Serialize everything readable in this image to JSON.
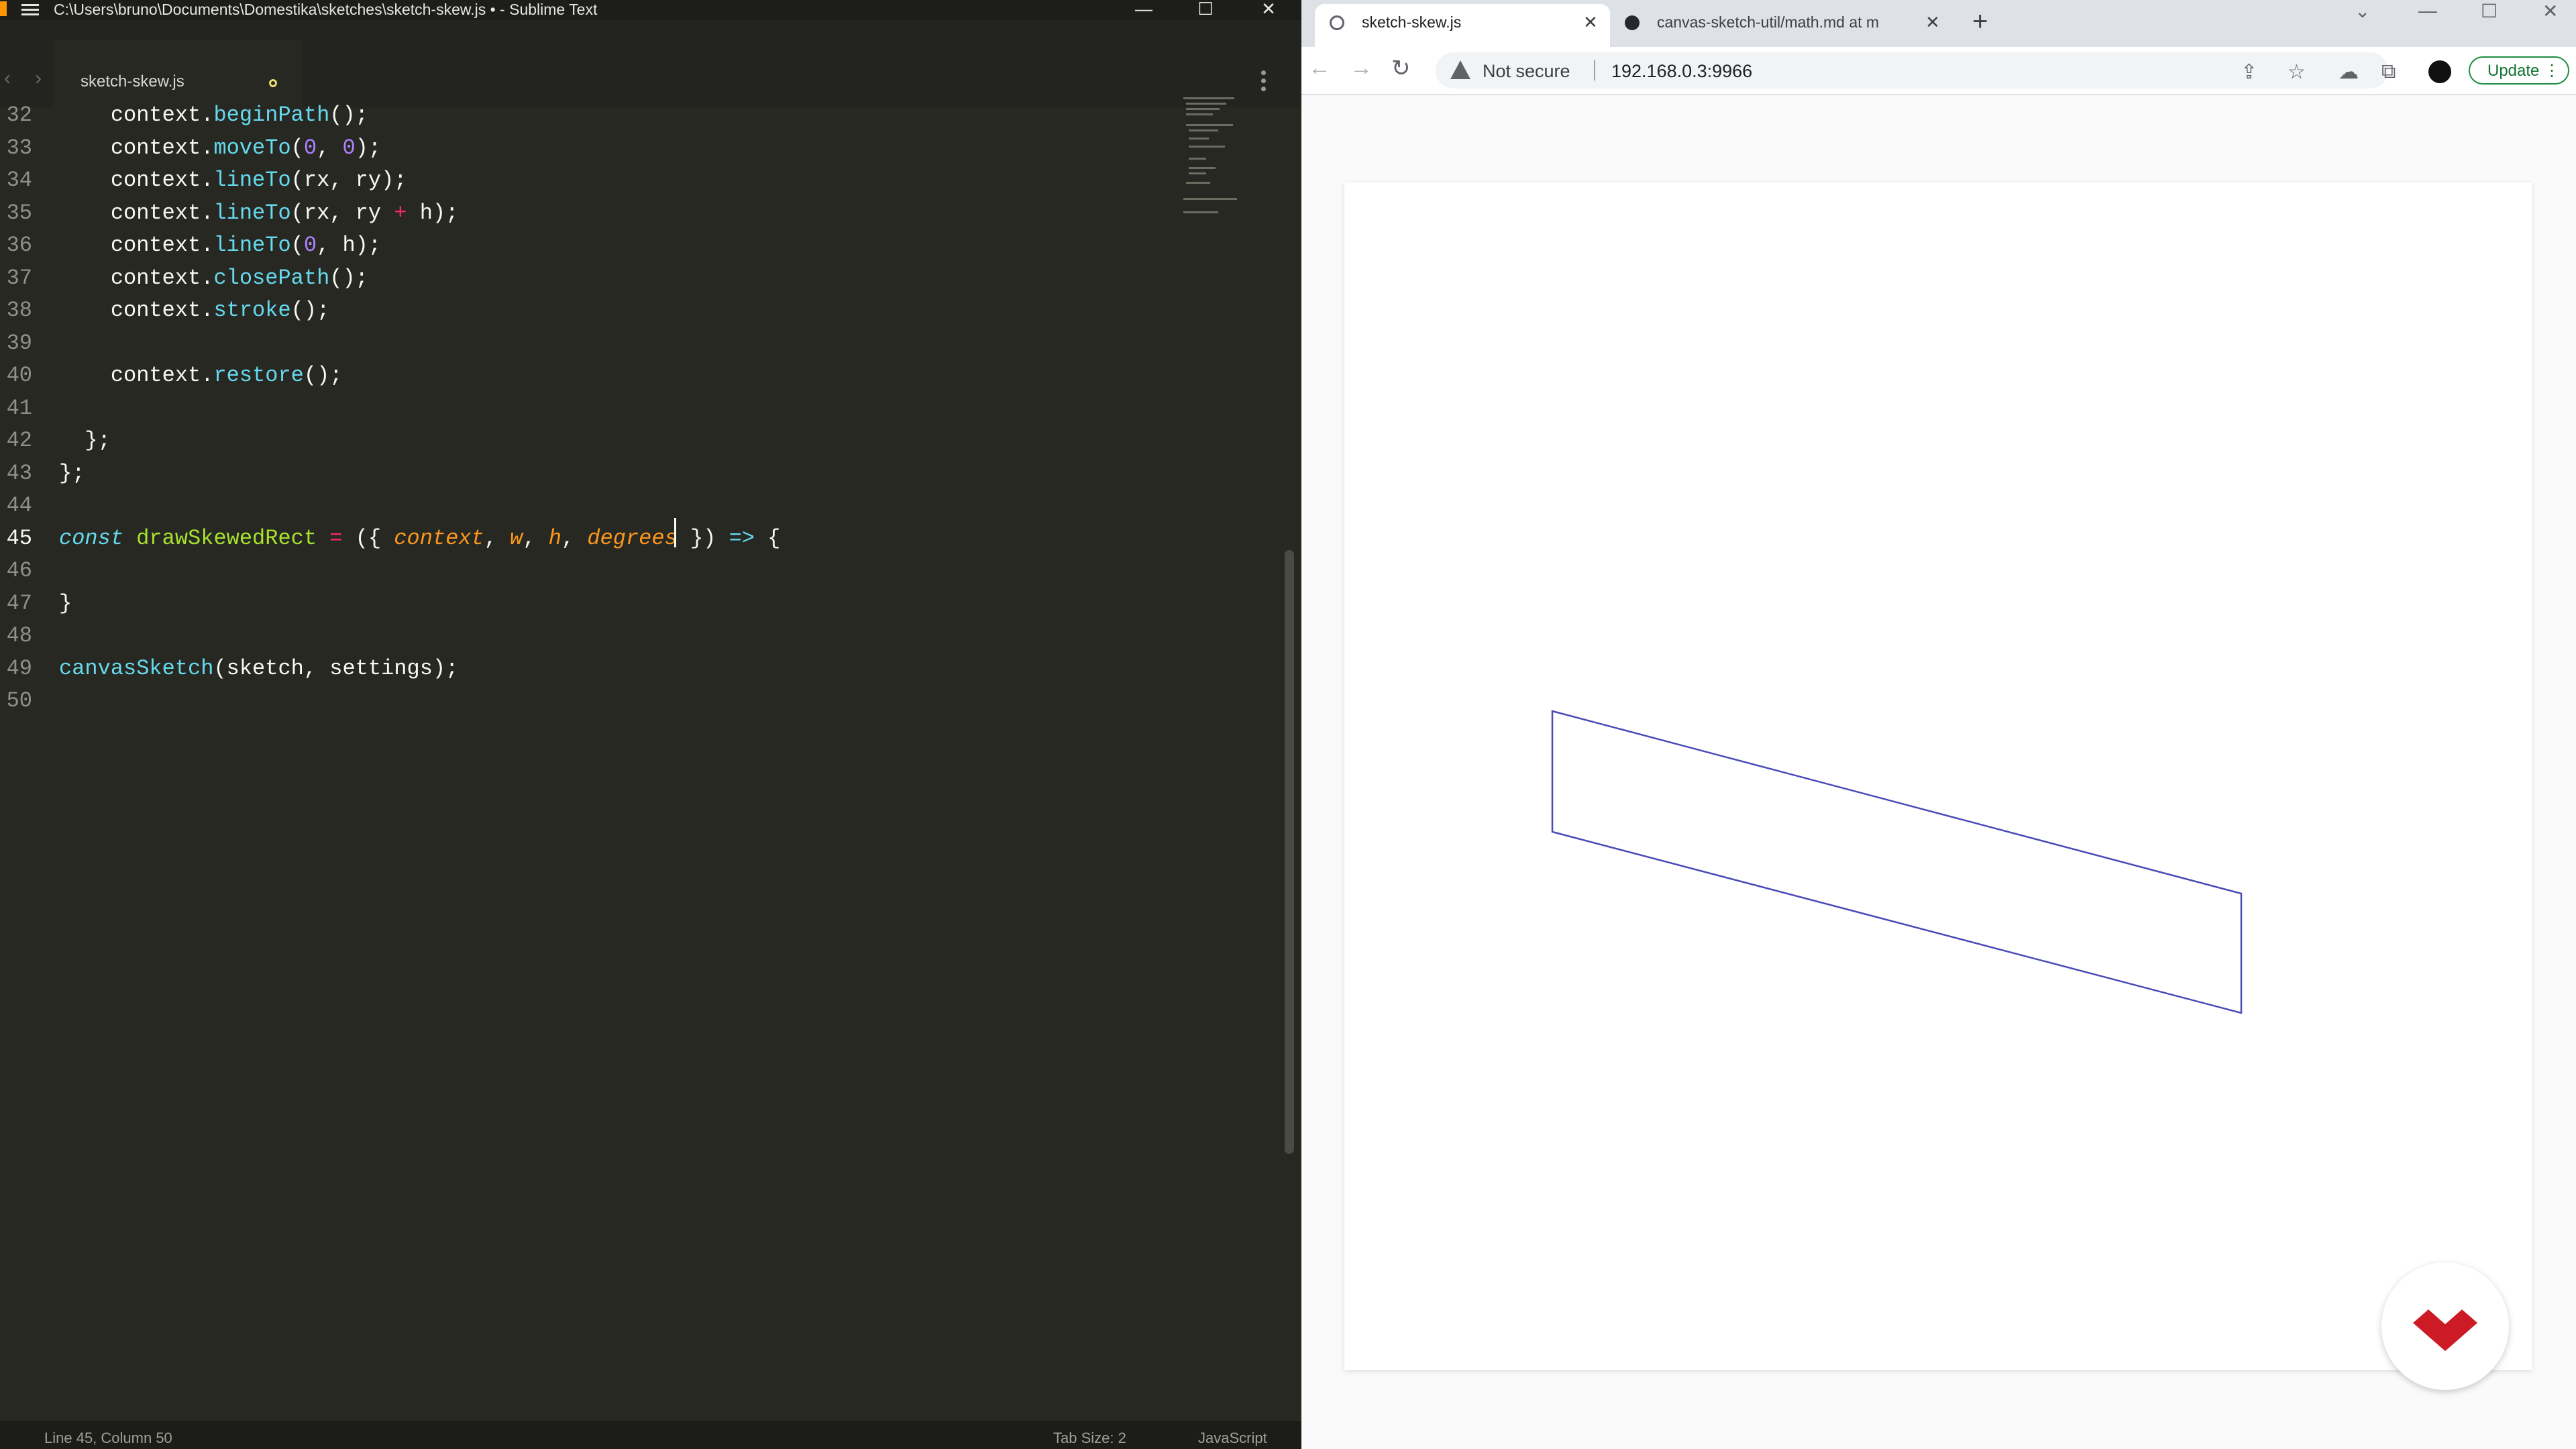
{
  "editor": {
    "window_title": "C:\\Users\\bruno\\Documents\\Domestika\\sketches\\sketch-skew.js • - Sublime Text",
    "window_controls": {
      "minimize": "—",
      "maximize": "☐",
      "close": "✕"
    },
    "tab": {
      "label": "sketch-skew.js"
    },
    "nav": {
      "back": "‹",
      "forward": "›"
    },
    "lines": [
      {
        "n": "32",
        "tokens": [
          {
            "t": "    context.",
            "c": ""
          },
          {
            "t": "beginPath",
            "c": "fn"
          },
          {
            "t": "();",
            "c": ""
          }
        ]
      },
      {
        "n": "33",
        "tokens": [
          {
            "t": "    context.",
            "c": ""
          },
          {
            "t": "moveTo",
            "c": "fn"
          },
          {
            "t": "(",
            "c": ""
          },
          {
            "t": "0",
            "c": "num"
          },
          {
            "t": ", ",
            "c": ""
          },
          {
            "t": "0",
            "c": "num"
          },
          {
            "t": ");",
            "c": ""
          }
        ]
      },
      {
        "n": "34",
        "tokens": [
          {
            "t": "    context.",
            "c": ""
          },
          {
            "t": "lineTo",
            "c": "fn"
          },
          {
            "t": "(rx, ry);",
            "c": ""
          }
        ]
      },
      {
        "n": "35",
        "tokens": [
          {
            "t": "    context.",
            "c": ""
          },
          {
            "t": "lineTo",
            "c": "fn"
          },
          {
            "t": "(rx, ry ",
            "c": ""
          },
          {
            "t": "+",
            "c": "op"
          },
          {
            "t": " h);",
            "c": ""
          }
        ]
      },
      {
        "n": "36",
        "tokens": [
          {
            "t": "    context.",
            "c": ""
          },
          {
            "t": "lineTo",
            "c": "fn"
          },
          {
            "t": "(",
            "c": ""
          },
          {
            "t": "0",
            "c": "num"
          },
          {
            "t": ", h);",
            "c": ""
          }
        ]
      },
      {
        "n": "37",
        "tokens": [
          {
            "t": "    context.",
            "c": ""
          },
          {
            "t": "closePath",
            "c": "fn"
          },
          {
            "t": "();",
            "c": ""
          }
        ]
      },
      {
        "n": "38",
        "tokens": [
          {
            "t": "    context.",
            "c": ""
          },
          {
            "t": "stroke",
            "c": "fn"
          },
          {
            "t": "();",
            "c": ""
          }
        ]
      },
      {
        "n": "39",
        "tokens": []
      },
      {
        "n": "40",
        "tokens": [
          {
            "t": "    context.",
            "c": ""
          },
          {
            "t": "restore",
            "c": "fn"
          },
          {
            "t": "();",
            "c": ""
          }
        ]
      },
      {
        "n": "41",
        "tokens": []
      },
      {
        "n": "42",
        "tokens": [
          {
            "t": "  };",
            "c": ""
          }
        ]
      },
      {
        "n": "43",
        "tokens": [
          {
            "t": "};",
            "c": ""
          }
        ]
      },
      {
        "n": "44",
        "tokens": []
      },
      {
        "n": "45",
        "tokens": [
          {
            "t": "const",
            "c": "kw"
          },
          {
            "t": " ",
            "c": ""
          },
          {
            "t": "drawSkewedRect",
            "c": "fnname"
          },
          {
            "t": " ",
            "c": ""
          },
          {
            "t": "=",
            "c": "op"
          },
          {
            "t": " ({ ",
            "c": ""
          },
          {
            "t": "context",
            "c": "param"
          },
          {
            "t": ", ",
            "c": ""
          },
          {
            "t": "w",
            "c": "param"
          },
          {
            "t": ", ",
            "c": ""
          },
          {
            "t": "h",
            "c": "param"
          },
          {
            "t": ", ",
            "c": ""
          },
          {
            "t": "degrees",
            "c": "param"
          },
          {
            "t": " }) ",
            "c": ""
          },
          {
            "t": "=>",
            "c": "kw"
          },
          {
            "t": " {",
            "c": ""
          }
        ],
        "current": true
      },
      {
        "n": "46",
        "tokens": []
      },
      {
        "n": "47",
        "tokens": [
          {
            "t": "}",
            "c": ""
          }
        ]
      },
      {
        "n": "48",
        "tokens": []
      },
      {
        "n": "49",
        "tokens": [
          {
            "t": "canvasSketch",
            "c": "fn"
          },
          {
            "t": "(sketch, settings);",
            "c": ""
          }
        ]
      },
      {
        "n": "50",
        "tokens": []
      }
    ],
    "status": {
      "position": "Line 45, Column 50",
      "tab_size": "Tab Size: 2",
      "syntax": "JavaScript"
    }
  },
  "browser": {
    "tabs": [
      {
        "label": "sketch-skew.js",
        "close": "✕"
      },
      {
        "label": "canvas-sketch-util/math.md at m",
        "close": "✕"
      }
    ],
    "new_tab": "+",
    "nav": {
      "back": "←",
      "forward": "→",
      "reload": "↻"
    },
    "address": {
      "security": "Not secure",
      "url": "192.168.0.3:9966"
    },
    "tools": {
      "share": "⇪",
      "star": "☆",
      "cloud": "☁",
      "extensions": "⧉"
    },
    "update_label": "Update",
    "update_menu": "⋮",
    "window_controls": {
      "tab_search": "⌄",
      "minimize": "—",
      "maximize": "☐",
      "close": "✕"
    }
  },
  "sketch": {
    "stroke_color": "#4b4bb8",
    "logo_color": "#cc1b24"
  }
}
